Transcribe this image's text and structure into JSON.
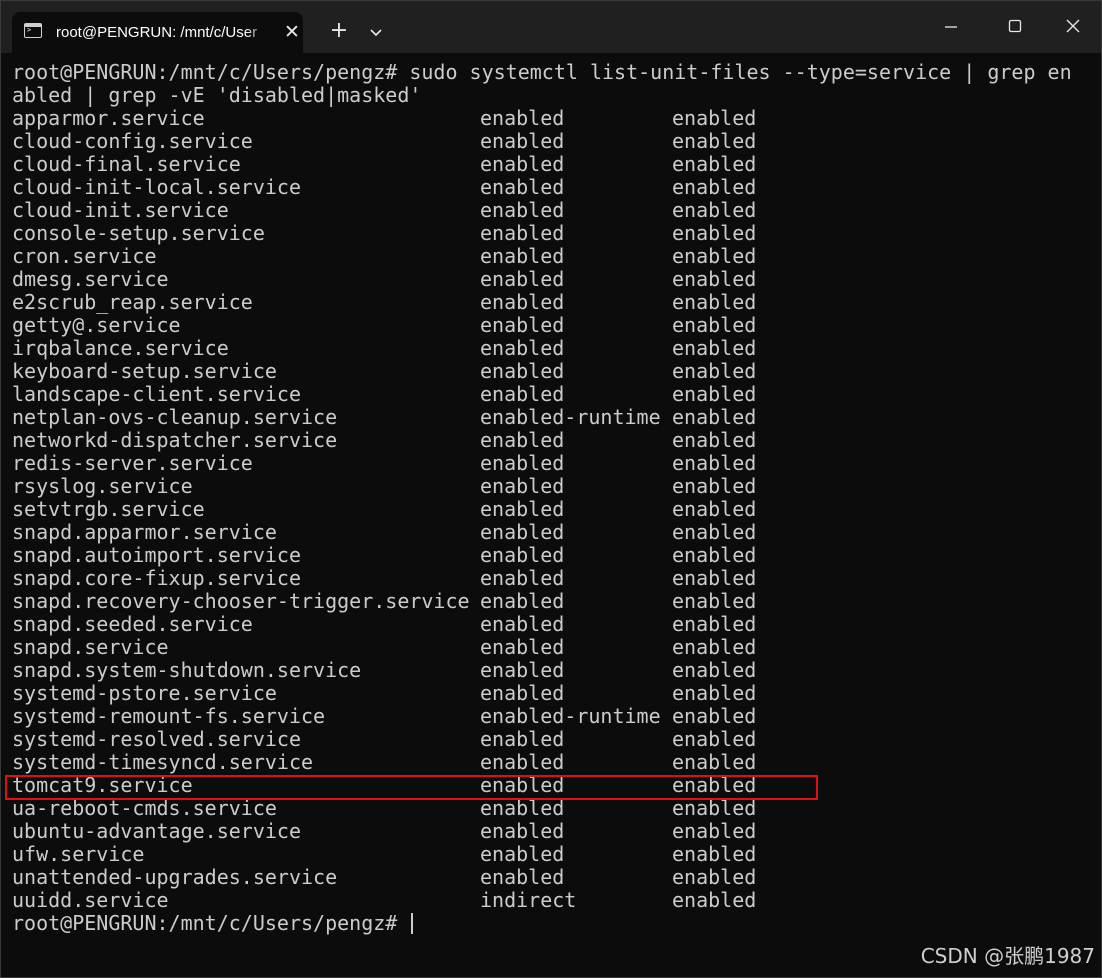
{
  "window": {
    "tab_title": "root@PENGRUN: /mnt/c/User",
    "tab_close_glyph": "✕",
    "new_tab_glyph": "+"
  },
  "terminal": {
    "command_line_1": "root@PENGRUN:/mnt/c/Users/pengz# sudo systemctl list-unit-files --type=service | grep en",
    "command_line_2": "abled | grep -vE 'disabled|masked'",
    "rows": [
      {
        "unit": "apparmor.service",
        "state": "enabled",
        "preset": "enabled"
      },
      {
        "unit": "cloud-config.service",
        "state": "enabled",
        "preset": "enabled"
      },
      {
        "unit": "cloud-final.service",
        "state": "enabled",
        "preset": "enabled"
      },
      {
        "unit": "cloud-init-local.service",
        "state": "enabled",
        "preset": "enabled"
      },
      {
        "unit": "cloud-init.service",
        "state": "enabled",
        "preset": "enabled"
      },
      {
        "unit": "console-setup.service",
        "state": "enabled",
        "preset": "enabled"
      },
      {
        "unit": "cron.service",
        "state": "enabled",
        "preset": "enabled"
      },
      {
        "unit": "dmesg.service",
        "state": "enabled",
        "preset": "enabled"
      },
      {
        "unit": "e2scrub_reap.service",
        "state": "enabled",
        "preset": "enabled"
      },
      {
        "unit": "getty@.service",
        "state": "enabled",
        "preset": "enabled"
      },
      {
        "unit": "irqbalance.service",
        "state": "enabled",
        "preset": "enabled"
      },
      {
        "unit": "keyboard-setup.service",
        "state": "enabled",
        "preset": "enabled"
      },
      {
        "unit": "landscape-client.service",
        "state": "enabled",
        "preset": "enabled"
      },
      {
        "unit": "netplan-ovs-cleanup.service",
        "state": "enabled-runtime",
        "preset": "enabled"
      },
      {
        "unit": "networkd-dispatcher.service",
        "state": "enabled",
        "preset": "enabled"
      },
      {
        "unit": "redis-server.service",
        "state": "enabled",
        "preset": "enabled"
      },
      {
        "unit": "rsyslog.service",
        "state": "enabled",
        "preset": "enabled"
      },
      {
        "unit": "setvtrgb.service",
        "state": "enabled",
        "preset": "enabled"
      },
      {
        "unit": "snapd.apparmor.service",
        "state": "enabled",
        "preset": "enabled"
      },
      {
        "unit": "snapd.autoimport.service",
        "state": "enabled",
        "preset": "enabled"
      },
      {
        "unit": "snapd.core-fixup.service",
        "state": "enabled",
        "preset": "enabled"
      },
      {
        "unit": "snapd.recovery-chooser-trigger.service",
        "state": "enabled",
        "preset": "enabled"
      },
      {
        "unit": "snapd.seeded.service",
        "state": "enabled",
        "preset": "enabled"
      },
      {
        "unit": "snapd.service",
        "state": "enabled",
        "preset": "enabled"
      },
      {
        "unit": "snapd.system-shutdown.service",
        "state": "enabled",
        "preset": "enabled"
      },
      {
        "unit": "systemd-pstore.service",
        "state": "enabled",
        "preset": "enabled"
      },
      {
        "unit": "systemd-remount-fs.service",
        "state": "enabled-runtime",
        "preset": "enabled"
      },
      {
        "unit": "systemd-resolved.service",
        "state": "enabled",
        "preset": "enabled"
      },
      {
        "unit": "systemd-timesyncd.service",
        "state": "enabled",
        "preset": "enabled"
      },
      {
        "unit": "tomcat9.service",
        "state": "enabled",
        "preset": "enabled"
      },
      {
        "unit": "ua-reboot-cmds.service",
        "state": "enabled",
        "preset": "enabled"
      },
      {
        "unit": "ubuntu-advantage.service",
        "state": "enabled",
        "preset": "enabled"
      },
      {
        "unit": "ufw.service",
        "state": "enabled",
        "preset": "enabled"
      },
      {
        "unit": "unattended-upgrades.service",
        "state": "enabled",
        "preset": "enabled"
      },
      {
        "unit": "uuidd.service",
        "state": "indirect",
        "preset": "enabled"
      }
    ],
    "prompt": "root@PENGRUN:/mnt/c/Users/pengz# ",
    "highlighted_row": "tomcat9.service",
    "highlight_color": "#e01010"
  },
  "watermark": "CSDN @张鹏1987",
  "colors": {
    "terminal_bg": "#0c0c0c",
    "titlebar_bg": "#202020",
    "text": "#cccccc"
  },
  "icons": {
    "tab": "terminal-icon",
    "dropdown": "chevron-down-icon",
    "minimize": "minimize-icon",
    "maximize": "maximize-icon",
    "close": "close-icon"
  }
}
